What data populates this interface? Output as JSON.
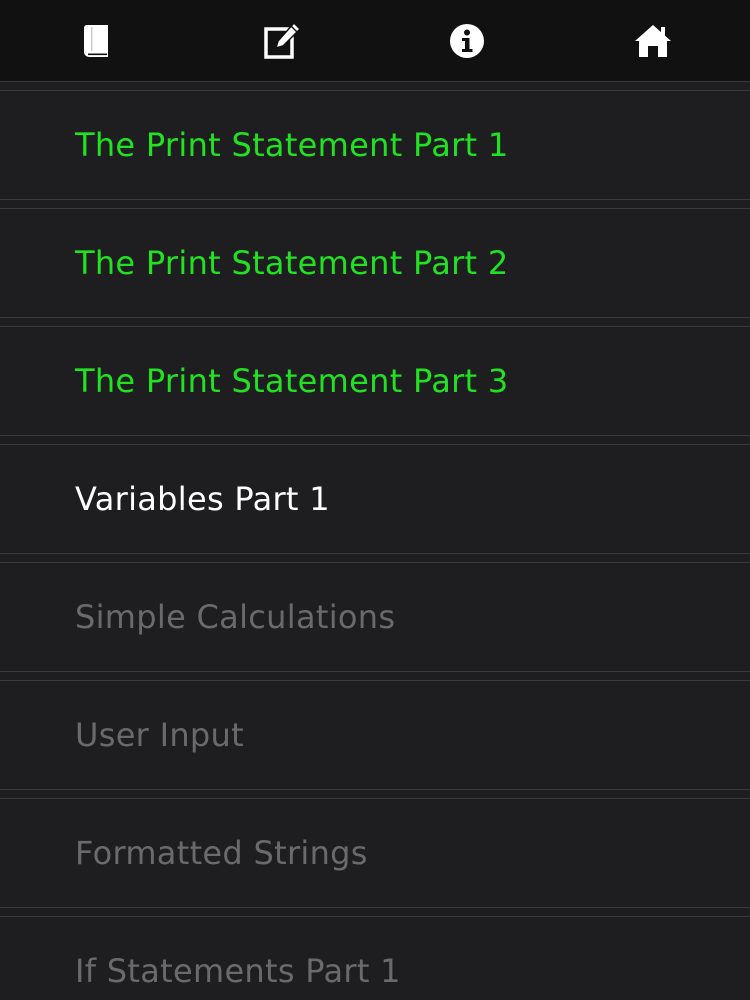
{
  "toolbar": {
    "buttons": [
      {
        "icon": "book-icon"
      },
      {
        "icon": "edit-icon"
      },
      {
        "icon": "info-icon"
      },
      {
        "icon": "home-icon"
      }
    ]
  },
  "colors": {
    "completed": "#22e022",
    "current": "#ffffff",
    "locked": "#6a6a6c",
    "background": "#1e1e20",
    "toolbar": "#111111"
  },
  "lessons": [
    {
      "label": "The Print Statement Part 1",
      "state": "completed"
    },
    {
      "label": "The Print Statement Part 2",
      "state": "completed"
    },
    {
      "label": "The Print Statement Part 3",
      "state": "completed"
    },
    {
      "label": "Variables Part 1",
      "state": "current"
    },
    {
      "label": "Simple Calculations",
      "state": "locked"
    },
    {
      "label": "User Input",
      "state": "locked"
    },
    {
      "label": "Formatted Strings",
      "state": "locked"
    },
    {
      "label": "If Statements Part 1",
      "state": "locked"
    }
  ]
}
